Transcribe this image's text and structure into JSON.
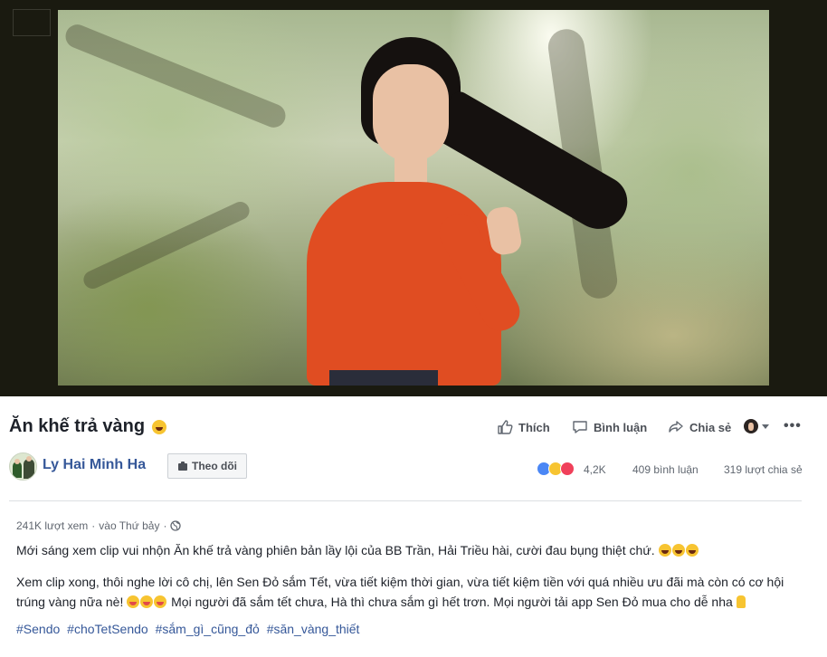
{
  "video": {
    "title": "Ăn khế trả vàng"
  },
  "actions": {
    "like_label": "Thích",
    "comment_label": "Bình luận",
    "share_label": "Chia sẻ",
    "more_label": "•••"
  },
  "page": {
    "name": "Ly Hai Minh Ha",
    "follow_label": "Theo dõi"
  },
  "stats": {
    "reaction_count": "4,2K",
    "comments": "409 bình luận",
    "shares": "319 lượt chia sẻ"
  },
  "post": {
    "views": "241K lượt xem",
    "separator": "·",
    "time": "vào Thứ bảy",
    "paragraph1": "Mới sáng xem clip vui nhộn Ăn khế trả vàng phiên bản lầy lội của BB Trần, Hải Triều hài, cười đau bụng thiệt chứ.",
    "paragraph2a": "Xem clip xong, thôi nghe lời cô chị, lên Sen Đỏ sắm Tết, vừa tiết kiệm thời gian, vừa tiết kiệm tiền với quá nhiều ưu đãi mà còn có cơ hội trúng vàng nữa nè!",
    "paragraph2b": "Mọi người đã sắm tết chưa, Hà thì chưa sắm gì hết trơn. Mọi người tải app Sen Đỏ mua cho dễ nha",
    "hashtags": [
      "#Sendo",
      "#choTetSendo",
      "#sắm_gì_cũng_đỏ",
      "#săn_vàng_thiết"
    ]
  },
  "colors": {
    "link": "#365899",
    "text": "#1d2129",
    "muted": "#606770",
    "player_bg": "#1a1a10"
  }
}
